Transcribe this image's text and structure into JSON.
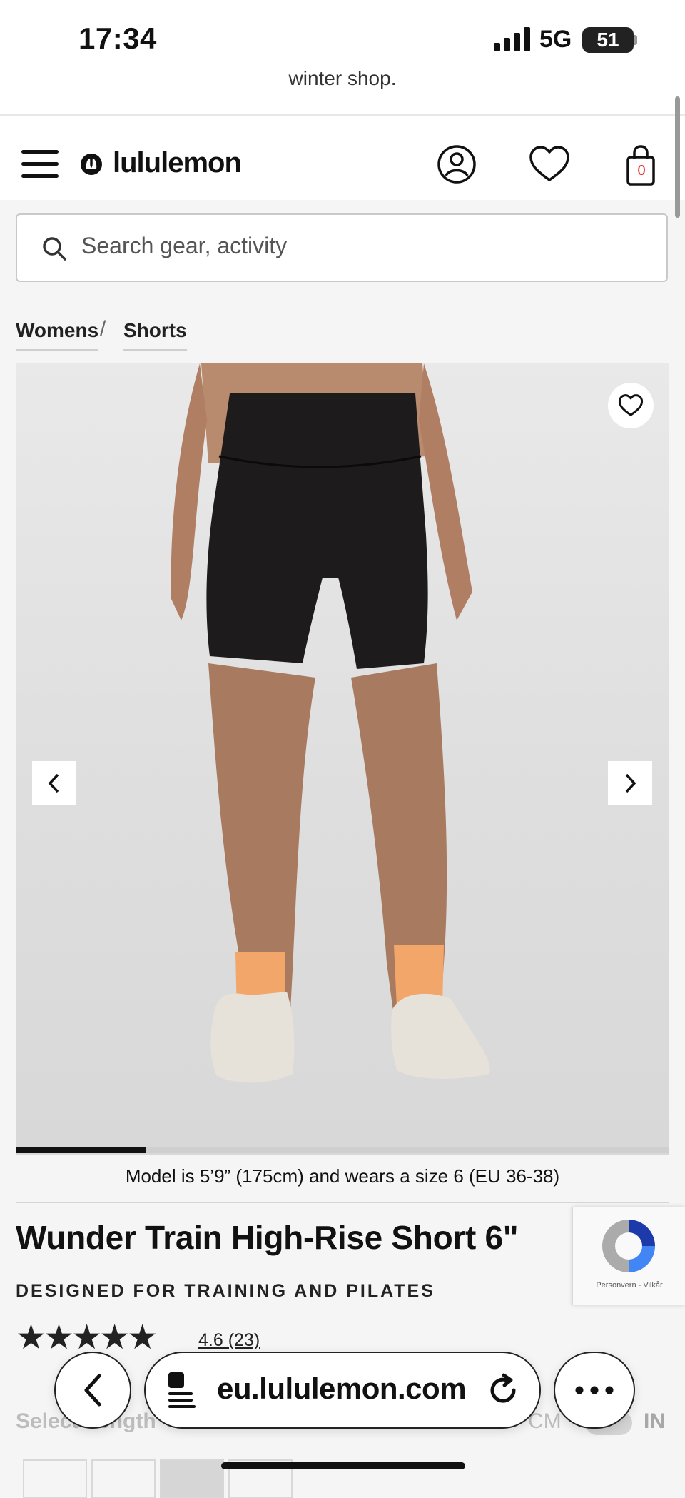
{
  "status": {
    "time": "17:34",
    "network": "5G",
    "battery": "51"
  },
  "promo": {
    "text": "winter shop."
  },
  "header": {
    "brand": "lululemon",
    "bag_count": "0"
  },
  "search": {
    "placeholder": "Search gear, activity"
  },
  "breadcrumb": {
    "items": [
      "Womens",
      "Shorts"
    ],
    "separator": "/"
  },
  "gallery": {
    "progress_fraction": 0.2
  },
  "product": {
    "model_note": "Model is 5’9” (175cm) and wears a size 6 (EU 36-38)",
    "name": "Wunder Train High-Rise Short 6\"",
    "tagline": "DESIGNED FOR TRAINING AND PILATES",
    "stars": "★★★★★",
    "rating": "4.6",
    "review_count": "(23)"
  },
  "length_selector": {
    "label": "Select Length",
    "unit_cm": "CM",
    "unit_in": "IN"
  },
  "recaptcha": {
    "text": "Personvern - Vilkår"
  },
  "browser": {
    "url": "eu.lululemon.com"
  }
}
